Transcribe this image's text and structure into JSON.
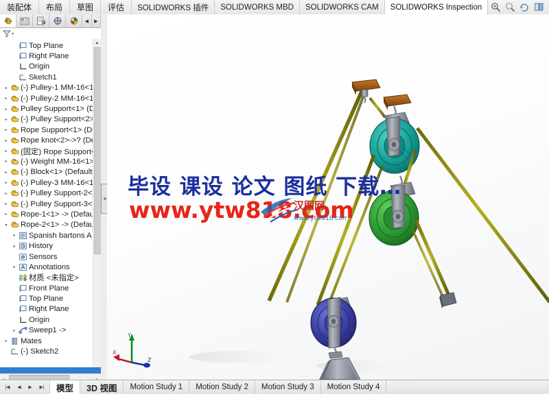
{
  "ribbon": {
    "tabs": [
      {
        "label": "装配体",
        "cn": true,
        "active": false
      },
      {
        "label": "布局",
        "cn": true,
        "active": false
      },
      {
        "label": "草图",
        "cn": true,
        "active": false
      },
      {
        "label": "评估",
        "cn": true,
        "active": false
      },
      {
        "label": "SOLIDWORKS 插件",
        "cn": false,
        "active": false
      },
      {
        "label": "SOLIDWORKS MBD",
        "cn": false,
        "active": false
      },
      {
        "label": "SOLIDWORKS CAM",
        "cn": false,
        "active": false
      },
      {
        "label": "SOLIDWORKS Inspection",
        "cn": false,
        "active": true
      }
    ],
    "icons": [
      {
        "name": "zoom-to-fit-icon",
        "caret": false
      },
      {
        "name": "zoom-to-area-icon",
        "caret": false
      },
      {
        "name": "rotate-view-icon",
        "caret": false
      },
      {
        "name": "view-orientation-icon",
        "caret": false
      },
      {
        "name": "section-view-icon",
        "caret": false
      },
      {
        "name": "display-style-icon",
        "caret": true
      },
      {
        "name": "hide-show-items-icon",
        "caret": true
      },
      {
        "name": "edit-appearance-icon",
        "caret": true
      },
      {
        "name": "apply-scene-icon",
        "caret": false
      },
      {
        "name": "view-settings-icon",
        "caret": true
      },
      {
        "name": "viewport-layout-icon",
        "caret": false
      }
    ]
  },
  "feature_manager": {
    "tabs": [
      {
        "name": "feature-tree-tab",
        "label": "FeatureManager",
        "active": true
      },
      {
        "name": "property-manager-tab",
        "label": "PropertyManager",
        "active": false
      },
      {
        "name": "configuration-manager-tab",
        "label": "ConfigurationManager",
        "active": false
      },
      {
        "name": "dimxpert-manager-tab",
        "label": "DimXpertManager",
        "active": false
      },
      {
        "name": "display-manager-tab",
        "label": "DisplayManager",
        "active": false
      }
    ],
    "filter_placeholder": "",
    "tree": [
      {
        "label": "Top Plane",
        "icon": "plane-icon",
        "arrow": false,
        "indent": 1
      },
      {
        "label": "Right Plane",
        "icon": "plane-icon",
        "arrow": false,
        "indent": 1
      },
      {
        "label": "Origin",
        "icon": "origin-icon",
        "arrow": false,
        "indent": 1
      },
      {
        "label": "Sketch1",
        "icon": "sketch-icon",
        "arrow": false,
        "indent": 1
      },
      {
        "label": "(-) Pulley-1  MM-16<1",
        "icon": "component-icon",
        "arrow": true,
        "indent": 0
      },
      {
        "label": "(-) Pulley-2  MM-16<1",
        "icon": "component-icon",
        "arrow": true,
        "indent": 0
      },
      {
        "label": "Pulley Support<1> (D",
        "icon": "component-icon",
        "arrow": true,
        "indent": 0
      },
      {
        "label": "(-) Pulley Support<2>",
        "icon": "component-icon",
        "arrow": true,
        "indent": 0
      },
      {
        "label": "Rope Support<1> (De",
        "icon": "component-icon",
        "arrow": true,
        "indent": 0
      },
      {
        "label": "Rope knot<2>->? (De",
        "icon": "component-icon",
        "arrow": true,
        "indent": 0
      },
      {
        "label": "(固定) Rope Support<",
        "icon": "component-icon",
        "arrow": true,
        "indent": 0
      },
      {
        "label": "(-) Weight MM-16<1>",
        "icon": "component-icon",
        "arrow": true,
        "indent": 0
      },
      {
        "label": "(-) Block<1> (Default<",
        "icon": "component-icon",
        "arrow": true,
        "indent": 0
      },
      {
        "label": "(-) Pulley-3  MM-16<1",
        "icon": "component-icon",
        "arrow": true,
        "indent": 0
      },
      {
        "label": "(-) Pulley Support-2<1",
        "icon": "component-icon",
        "arrow": true,
        "indent": 0
      },
      {
        "label": "(-) Pulley Support-3<1",
        "icon": "component-icon",
        "arrow": true,
        "indent": 0
      },
      {
        "label": "Rope-1<1> -> (Defau",
        "icon": "component-icon",
        "arrow": true,
        "indent": 0
      },
      {
        "label": "Rope-2<1> -> (Defau",
        "icon": "component-icon",
        "arrow": "down",
        "indent": 0
      },
      {
        "label": "Spanish bartons  A",
        "icon": "subassembly-icon",
        "arrow": true,
        "indent": 1
      },
      {
        "label": "History",
        "icon": "history-icon",
        "arrow": true,
        "indent": 1
      },
      {
        "label": "Sensors",
        "icon": "sensors-icon",
        "arrow": false,
        "indent": 1
      },
      {
        "label": "Annotations",
        "icon": "annotations-icon",
        "arrow": true,
        "indent": 1
      },
      {
        "label": "材质 <未指定>",
        "icon": "material-icon",
        "arrow": false,
        "indent": 1
      },
      {
        "label": "Front Plane",
        "icon": "plane-icon",
        "arrow": false,
        "indent": 1
      },
      {
        "label": "Top Plane",
        "icon": "plane-icon",
        "arrow": false,
        "indent": 1
      },
      {
        "label": "Right Plane",
        "icon": "plane-icon",
        "arrow": false,
        "indent": 1
      },
      {
        "label": "Origin",
        "icon": "origin-icon",
        "arrow": false,
        "indent": 1
      },
      {
        "label": "Sweep1 ->",
        "icon": "sweep-icon",
        "arrow": true,
        "indent": 1
      },
      {
        "label": "Mates",
        "icon": "mates-icon",
        "arrow": true,
        "indent": 0
      },
      {
        "label": "(-) Sketch2",
        "icon": "sketch-icon",
        "arrow": false,
        "indent": 0
      }
    ]
  },
  "viewport": {
    "watermark_line1": "毕设 课设 论文 图纸 下载…",
    "watermark_line2": "www.ytw818.com",
    "watermark_logo_text": "汉图网",
    "watermark_logo_sub": "www.ytw818.com",
    "triad_labels": {
      "x": "X",
      "y": "Y",
      "z": "Z"
    }
  },
  "bottom": {
    "nav_buttons": [
      "first-page-icon",
      "previous-page-icon",
      "next-page-icon",
      "last-page-icon"
    ],
    "tabs": [
      {
        "label": "模型",
        "cn": true,
        "active": true
      },
      {
        "label": "3D 视图",
        "cn": true,
        "active": false
      },
      {
        "label": "Motion Study 1",
        "cn": false,
        "active": false
      },
      {
        "label": "Motion Study 2",
        "cn": false,
        "active": false
      },
      {
        "label": "Motion Study 3",
        "cn": false,
        "active": false
      },
      {
        "label": "Motion Study 4",
        "cn": false,
        "active": false
      }
    ]
  },
  "colors": {
    "teal_pulley": "#1f9e96",
    "green_pulley": "#2f9b3a",
    "blue_pulley": "#3b3f9e",
    "rope_olive": "#8d8a17",
    "wood_brown": "#9a5a1e",
    "steel_gray": "#8e929b",
    "watermark_blue": "#1b2f9e",
    "watermark_red": "#e8241a"
  }
}
